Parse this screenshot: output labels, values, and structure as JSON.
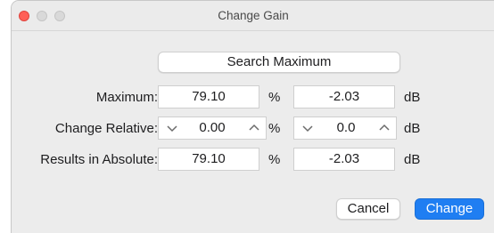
{
  "window": {
    "title": "Change Gain"
  },
  "buttons": {
    "search": "Search Maximum",
    "cancel": "Cancel",
    "change": "Change"
  },
  "rows": [
    {
      "label": "Maximum:",
      "percent": "79.10",
      "percent_unit": "%",
      "db": "-2.03",
      "db_unit": "dB"
    },
    {
      "label": "Change Relative:",
      "percent": "0.00",
      "percent_unit": "%",
      "db": "0.0",
      "db_unit": "dB"
    },
    {
      "label": "Results in Absolute:",
      "percent": "79.10",
      "percent_unit": "%",
      "db": "-2.03",
      "db_unit": "dB"
    }
  ],
  "icons": {
    "decrement": "chevron-down-icon",
    "increment": "chevron-up-icon"
  },
  "colors": {
    "accent": "#1f7ef2",
    "close": "#ff5f57"
  }
}
